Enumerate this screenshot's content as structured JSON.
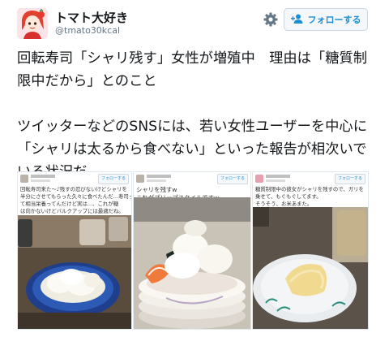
{
  "header": {
    "display_name": "トマト大好き",
    "handle": "@tmato30kcal",
    "follow_label": "フォローする",
    "settings_icon": "gear-icon",
    "follow_icon": "add-user-icon"
  },
  "tweet": {
    "text": "回転寿司「シャリ残す」女性が増殖中　理由は「糖質制限中だから」とのこと\n\nツイッターなどのSNSには、若い女性ユーザーを中心に「シャリは太るから食べない」といった報告が相次いでいる状況だ"
  },
  "media": [
    {
      "follow_label": "フォローする",
      "text": "回転寿司来た〜♪残すの忍びないけどシャリを\n半分にさせてもらった久々に食べたんだ…寿司って\nて相当栄養ってんだけど実は…、これが糖\nは向かないけどバルクアップには最適だね。"
    },
    {
      "follow_label": "フォローする",
      "text": "シャリを残すw\nこれがプリップスタイルですw"
    },
    {
      "follow_label": "フォローする",
      "text": "糖質制限中の彼女がシャリを残すので、ガリを\n乗せて、もぐもぐしてます。\nそうそう、お米あまた。"
    }
  ],
  "colors": {
    "accent": "#1d8ed1",
    "text": "#14171a",
    "muted": "#657786"
  }
}
